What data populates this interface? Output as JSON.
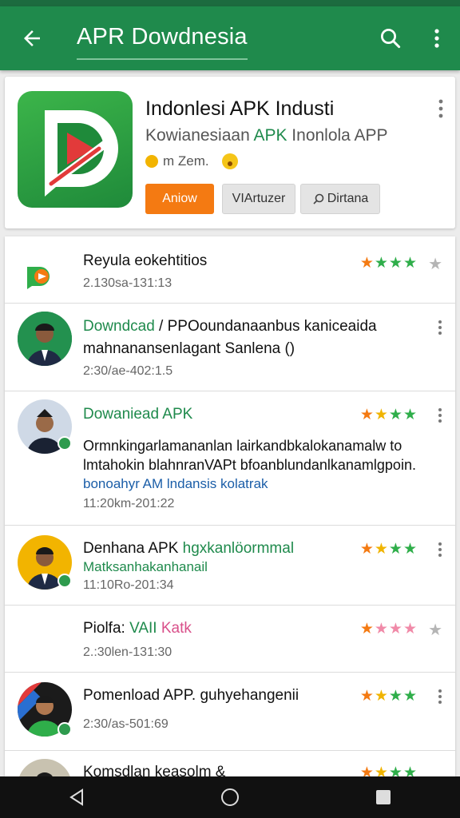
{
  "appbar": {
    "title": "APR Dowdnesia",
    "back_icon": "arrow-back-icon",
    "search_icon": "search-icon",
    "menu_icon": "more-vert-icon"
  },
  "app": {
    "name": "Indonlesi APK Industi",
    "subtitle_prefix": "Kowianesiaan ",
    "subtitle_green": "APK",
    "subtitle_suffix": " Inonlola APP",
    "meta": "m Zem.",
    "buttons": {
      "install": "Aniow",
      "second": "VIArtuzer",
      "third": "Dirtana"
    }
  },
  "list": [
    {
      "title": "Reyula eokehtitios",
      "date": "2.130sa-131:13"
    },
    {
      "title_green": "Downdcad",
      "title_rest": " / PPOoundanaanbus kaniceaida",
      "line2": "mahnanansenlagant Sanlena ()",
      "date": "2:30/ae-402:1.5"
    },
    {
      "title": "Dowaniead APK",
      "line2": "Ormnkingarlamananlan lairkandbkalokanamalw to",
      "line3": "lmtahokin blahnranVAPt bfoanblundanlkanamlgpoin.",
      "line4": "bonoahyr AM lndansis kolatrak",
      "date": "11:20km-201:22"
    },
    {
      "title_black": "Denhana APK ",
      "title_green": "hgxkanlöormmal",
      "line2": "Matksanhakanhanail",
      "date": "11:10Ro-201:34"
    },
    {
      "title_black": "Piolfa: ",
      "title_green": "VAII",
      "title_pink": " Katk",
      "date": "2.:30len-131:30"
    },
    {
      "title": "Pomenload APP. guhyehangenii",
      "date": "2:30/as-501:69"
    },
    {
      "title": "Komsdlan keasolm &"
    }
  ],
  "colors": {
    "appbar": "#1f8a4c",
    "accent_orange": "#f47a12",
    "green": "#1f8a4c"
  },
  "navbar": {
    "back": "nav-back-icon",
    "home": "nav-home-icon",
    "recents": "nav-recents-icon"
  }
}
